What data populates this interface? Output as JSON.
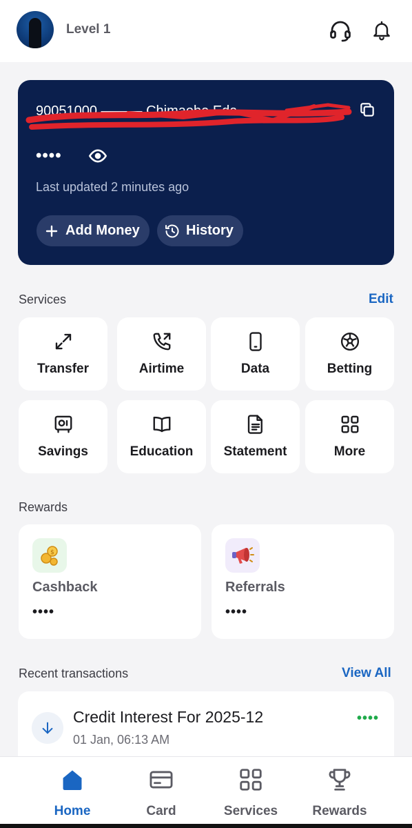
{
  "header": {
    "level": "Level 1",
    "icons": [
      "support-headset-icon",
      "notification-bell-icon"
    ]
  },
  "balance_card": {
    "account_line": "90051000 ——— Chimaobe Eda...",
    "balance_hidden": "••••",
    "last_updated": "Last updated 2 minutes ago",
    "add_money_label": "Add Money",
    "history_label": "History"
  },
  "services": {
    "title": "Services",
    "edit_label": "Edit",
    "items": [
      {
        "label": "Transfer",
        "icon": "transfer-arrows-icon"
      },
      {
        "label": "Airtime",
        "icon": "phone-call-icon"
      },
      {
        "label": "Data",
        "icon": "mobile-device-icon"
      },
      {
        "label": "Betting",
        "icon": "soccer-ball-icon"
      },
      {
        "label": "Savings",
        "icon": "safe-icon"
      },
      {
        "label": "Education",
        "icon": "book-icon"
      },
      {
        "label": "Statement",
        "icon": "document-icon"
      },
      {
        "label": "More",
        "icon": "grid-icon"
      }
    ]
  },
  "rewards": {
    "title": "Rewards",
    "items": [
      {
        "label": "Cashback",
        "value": "••••",
        "icon": "coins-icon"
      },
      {
        "label": "Referrals",
        "value": "••••",
        "icon": "megaphone-icon"
      }
    ]
  },
  "transactions": {
    "title": "Recent transactions",
    "view_all_label": "View All",
    "items": [
      {
        "title": "Credit Interest For 2025-12",
        "date": "01 Jan, 06:13 AM",
        "amount": "••••"
      }
    ]
  },
  "tabbar": {
    "tabs": [
      {
        "label": "Home",
        "icon": "home-icon",
        "active": true
      },
      {
        "label": "Card",
        "icon": "card-icon",
        "active": false
      },
      {
        "label": "Services",
        "icon": "services-grid-icon",
        "active": false
      },
      {
        "label": "Rewards",
        "icon": "trophy-icon",
        "active": false
      }
    ]
  },
  "colors": {
    "card_bg": "#0b1f4d",
    "accent": "#1a66c2",
    "positive": "#1faa4a",
    "redaction": "#e0242b"
  }
}
